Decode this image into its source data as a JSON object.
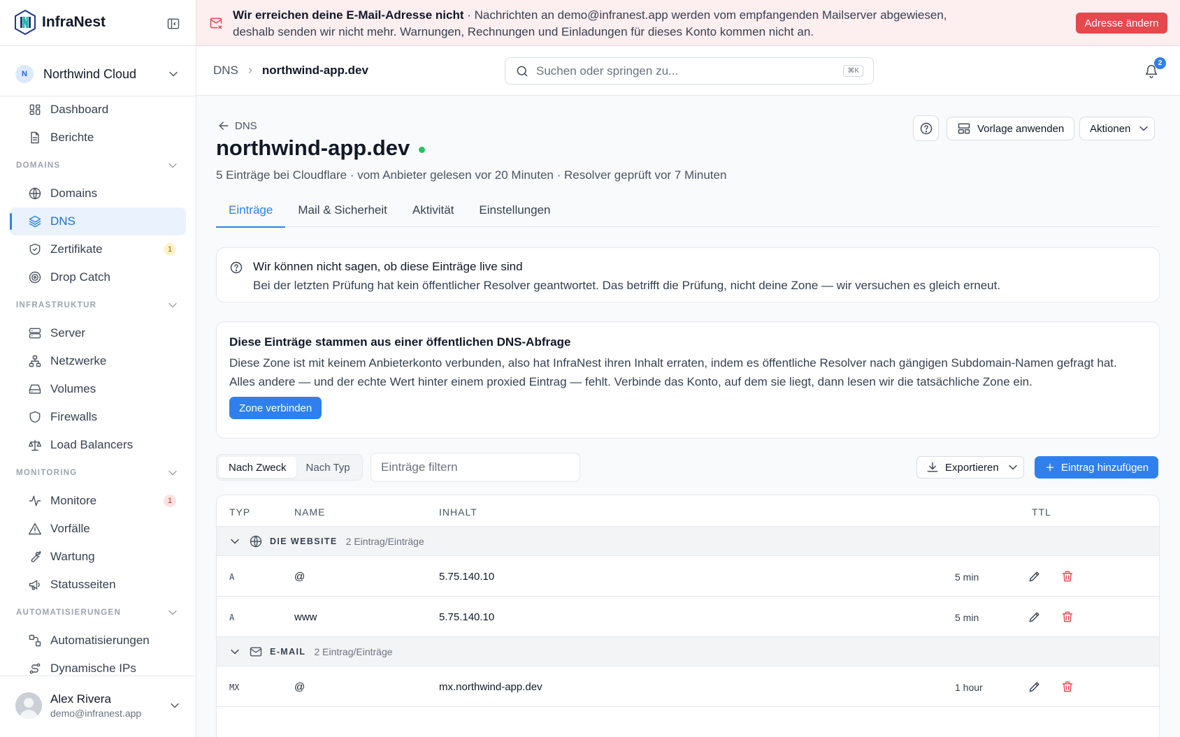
{
  "app": {
    "name": "InfraNest"
  },
  "org": {
    "initial": "N",
    "name": "Northwind Cloud"
  },
  "sidebar": {
    "top": [
      {
        "label": "Dashboard",
        "icon": "dashboard-icon"
      },
      {
        "label": "Berichte",
        "icon": "document-icon"
      }
    ],
    "sections": [
      {
        "title": "DOMAINS",
        "items": [
          {
            "label": "Domains",
            "icon": "globe-icon"
          },
          {
            "label": "DNS",
            "icon": "layers-icon",
            "active": true
          },
          {
            "label": "Zertifikate",
            "icon": "shield-check-icon",
            "badge": "1",
            "badge_color": "yellow"
          },
          {
            "label": "Drop Catch",
            "icon": "target-icon"
          }
        ]
      },
      {
        "title": "INFRASTRUKTUR",
        "items": [
          {
            "label": "Server",
            "icon": "server-icon"
          },
          {
            "label": "Netzwerke",
            "icon": "network-icon"
          },
          {
            "label": "Volumes",
            "icon": "drive-icon"
          },
          {
            "label": "Firewalls",
            "icon": "shield-icon"
          },
          {
            "label": "Load Balancers",
            "icon": "scale-icon"
          }
        ]
      },
      {
        "title": "MONITORING",
        "items": [
          {
            "label": "Monitore",
            "icon": "activity-icon",
            "badge": "1",
            "badge_color": "red"
          },
          {
            "label": "Vorfälle",
            "icon": "warning-icon"
          },
          {
            "label": "Wartung",
            "icon": "wrench-icon"
          },
          {
            "label": "Statusseiten",
            "icon": "megaphone-icon"
          }
        ]
      },
      {
        "title": "AUTOMATISIERUNGEN",
        "items": [
          {
            "label": "Automatisierungen",
            "icon": "workflow-icon"
          },
          {
            "label": "Dynamische IPs",
            "icon": "route-icon"
          }
        ]
      }
    ]
  },
  "user": {
    "name": "Alex Rivera",
    "email": "demo@infranest.app"
  },
  "banner": {
    "title": "Wir erreichen deine E-Mail-Adresse nicht",
    "text": " · Nachrichten an demo@infranest.app werden vom empfangenden Mailserver abgewiesen, deshalb senden wir nicht mehr. Warnungen, Rechnungen und Einladungen für dieses Konto kommen nicht an.",
    "button": "Adresse ändern"
  },
  "topbar": {
    "breadcrumb_root": "DNS",
    "breadcrumb_current": "northwind-app.dev",
    "search_placeholder": "Suchen oder springen zu...",
    "search_shortcut": "⌘K",
    "notification_count": "2"
  },
  "page": {
    "back_label": "DNS",
    "title": "northwind-app.dev",
    "subtitle": "5 Einträge bei Cloudflare · vom Anbieter gelesen vor 20 Minuten · Resolver geprüft vor 7 Minuten",
    "apply_template": "Vorlage anwenden",
    "actions": "Aktionen",
    "tabs": [
      "Einträge",
      "Mail & Sicherheit",
      "Aktivität",
      "Einstellungen"
    ],
    "active_tab": 0
  },
  "notice": {
    "title": "Wir können nicht sagen, ob diese Einträge live sind",
    "text": "Bei der letzten Prüfung hat kein öffentlicher Resolver geantwortet. Das betrifft die Prüfung, nicht deine Zone — wir versuchen es gleich erneut."
  },
  "public_dns": {
    "title": "Diese Einträge stammen aus einer öffentlichen DNS-Abfrage",
    "text": "Diese Zone ist mit keinem Anbieterkonto verbunden, also hat InfraNest ihren Inhalt erraten, indem es öffentliche Resolver nach gängigen Subdomain-Namen gefragt hat. Alles andere — und der echte Wert hinter einem proxied Eintrag — fehlt. Verbinde das Konto, auf dem sie liegt, dann lesen wir die tatsächliche Zone ein.",
    "button": "Zone verbinden"
  },
  "toolbar": {
    "view_purpose": "Nach Zweck",
    "view_type": "Nach Typ",
    "filter_placeholder": "Einträge filtern",
    "export": "Exportieren",
    "add": "Eintrag hinzufügen"
  },
  "table": {
    "headers": {
      "type": "TYP",
      "name": "NAME",
      "content": "INHALT",
      "ttl": "TTL"
    },
    "groups": [
      {
        "name": "DIE WEBSITE",
        "icon": "globe-icon",
        "count": "2 Eintrag/Einträge",
        "rows": [
          {
            "type": "A",
            "name": "@",
            "content": "5.75.140.10",
            "ttl": "5 min"
          },
          {
            "type": "A",
            "name": "www",
            "content": "5.75.140.10",
            "ttl": "5 min"
          }
        ]
      },
      {
        "name": "E-MAIL",
        "icon": "mail-icon",
        "count": "2 Eintrag/Einträge",
        "rows": [
          {
            "type": "MX",
            "name": "@",
            "content": "mx.northwind-app.dev",
            "ttl": "1 hour"
          }
        ]
      }
    ]
  },
  "colors": {
    "accent": "#2f80ed",
    "danger": "#e5484d",
    "success": "#22c55e",
    "banner_bg": "#fdeef0"
  }
}
